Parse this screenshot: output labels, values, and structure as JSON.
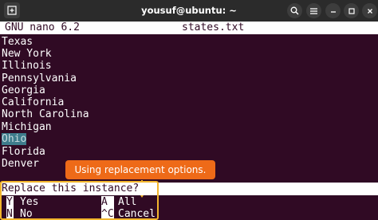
{
  "window": {
    "title": "yousuf@ubuntu: ~"
  },
  "icons": {
    "new_tab": "new-tab-icon",
    "search": "search-icon",
    "menu": "hamburger-icon",
    "minimize": "minimize-icon",
    "maximize": "maximize-icon",
    "close": "close-icon"
  },
  "nano": {
    "version": "GNU nano 6.2",
    "filename": "states.txt"
  },
  "lines": [
    "Texas",
    "New York",
    "Illinois",
    "Pennsylvania",
    "Georgia",
    "California",
    "North Carolina",
    "Michigan",
    "Ohio",
    "Florida",
    "Denver"
  ],
  "highlighted_line_index": 8,
  "callout": {
    "text": "Using replacement options."
  },
  "prompt": {
    "text": "Replace this instance?"
  },
  "options": [
    {
      "key": "Y",
      "label": "Yes"
    },
    {
      "key": "N",
      "label": "No"
    },
    {
      "key": "A",
      "label": "All"
    },
    {
      "key": "^C",
      "label": "Cancel"
    }
  ],
  "colors": {
    "terminal_bg": "#300a24",
    "titlebar_bg": "#2b2b2b",
    "highlight": "#3e7c8c",
    "callout": "#ee6a18",
    "frame": "#f2b52c"
  }
}
